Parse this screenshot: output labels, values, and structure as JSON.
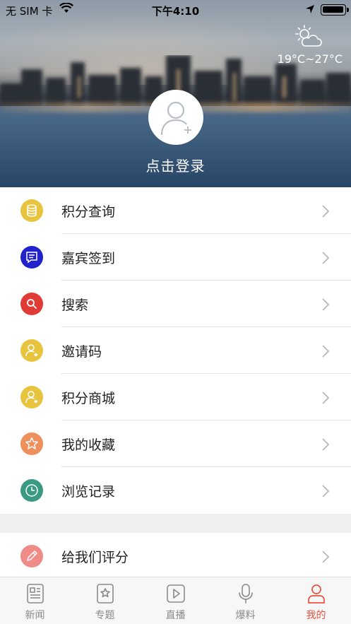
{
  "status_bar": {
    "carrier": "无 SIM 卡",
    "time": "下午4:10"
  },
  "weather": {
    "temp": "19°C~27°C",
    "icon": "partly-cloudy-icon"
  },
  "profile": {
    "login_text": "点击登录",
    "avatar_icon": "user-add-icon"
  },
  "menu": [
    {
      "label": "积分查询",
      "icon": "coins-icon",
      "color": "#e8c43e"
    },
    {
      "label": "嘉宾签到",
      "icon": "message-icon",
      "color": "#2222cc"
    },
    {
      "label": "搜索",
      "icon": "search-icon",
      "color": "#e03b35"
    },
    {
      "label": "邀请码",
      "icon": "user-share-icon",
      "color": "#e8c43e"
    },
    {
      "label": "积分商城",
      "icon": "user-share-icon",
      "color": "#e8c43e"
    },
    {
      "label": "我的收藏",
      "icon": "star-icon",
      "color": "#ef8f5c"
    },
    {
      "label": "浏览记录",
      "icon": "clock-icon",
      "color": "#3a9a84"
    }
  ],
  "menu_secondary": [
    {
      "label": "给我们评分",
      "icon": "pencil-icon",
      "color": "#ef8c88"
    }
  ],
  "tabs": [
    {
      "label": "新闻",
      "icon": "news-icon",
      "active": false
    },
    {
      "label": "专题",
      "icon": "topic-star-icon",
      "active": false
    },
    {
      "label": "直播",
      "icon": "play-icon",
      "active": false
    },
    {
      "label": "爆料",
      "icon": "microphone-icon",
      "active": false
    },
    {
      "label": "我的",
      "icon": "person-icon",
      "active": true
    }
  ],
  "colors": {
    "accent": "#e8523f",
    "tab_inactive": "#8a8a8a",
    "separator": "#e3e3e3"
  }
}
